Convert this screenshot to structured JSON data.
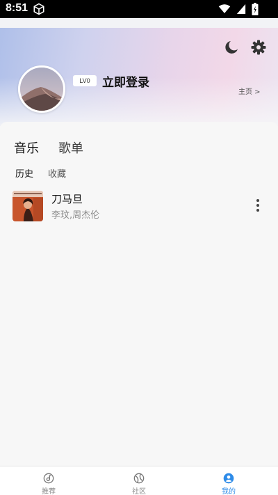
{
  "status_bar": {
    "time": "8:51",
    "icons": [
      "cube-icon",
      "wifi-icon",
      "signal-icon",
      "battery-icon"
    ]
  },
  "header": {
    "icons": [
      "moon-icon",
      "gear-icon"
    ],
    "level": "LV0",
    "login": "立即登录",
    "homepage": "主页 >"
  },
  "tabs": [
    {
      "label": "音乐",
      "selected": true
    },
    {
      "label": "歌单",
      "selected": false
    }
  ],
  "subtabs": [
    {
      "label": "历史",
      "selected": true
    },
    {
      "label": "收藏",
      "selected": false
    }
  ],
  "songs": [
    {
      "title": "刀马旦",
      "artist": "李玟,周杰伦",
      "cover_icon": "album-cover",
      "more_icon": "more-vertical-icon"
    }
  ],
  "bottom_nav": [
    {
      "label": "推荐",
      "icon": "disc-icon",
      "active": false
    },
    {
      "label": "社区",
      "icon": "community-icon",
      "active": false
    },
    {
      "label": "我的",
      "icon": "user-icon",
      "active": true
    }
  ],
  "colors": {
    "accent": "#2d8be8",
    "status_bar": "#000000"
  }
}
